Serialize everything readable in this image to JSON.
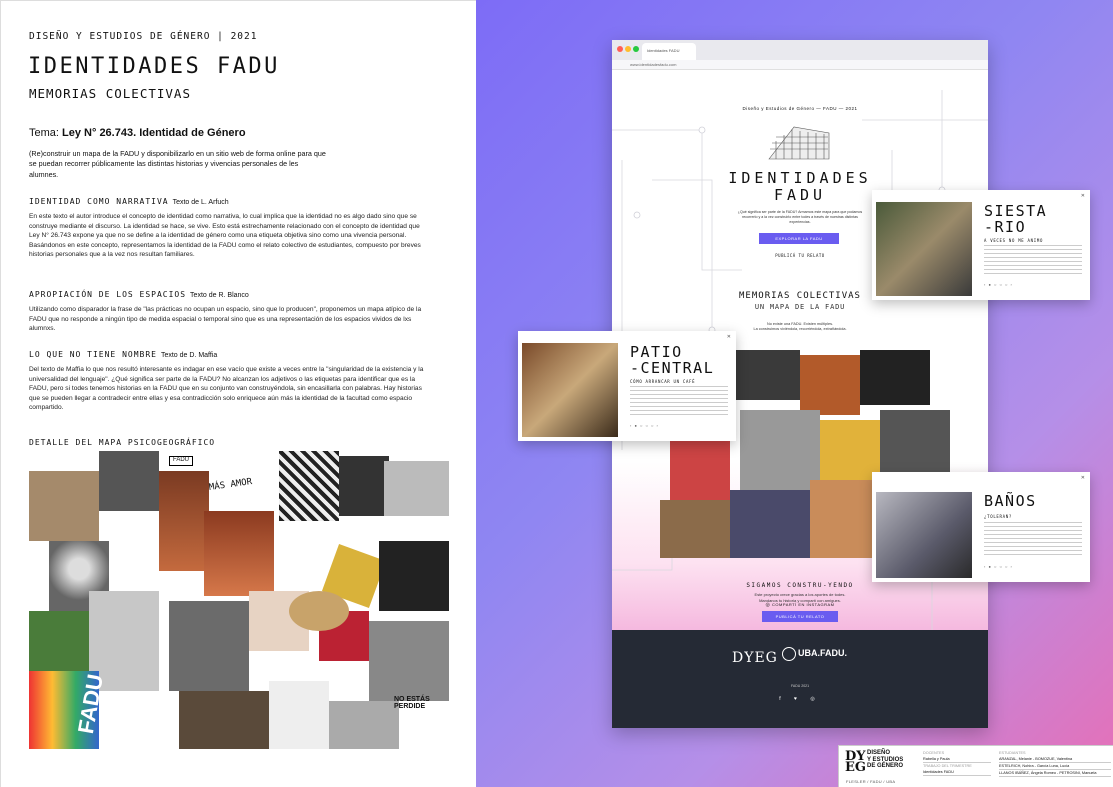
{
  "left": {
    "kicker": "DISEÑO Y ESTUDIOS DE GÉNERO | 2021",
    "title": "IDENTIDADES FADU",
    "subtitle": "MEMORIAS COLECTIVAS",
    "tema_label": "Tema:",
    "tema_value": "Ley N° 26.743. Identidad de Género",
    "intro": "(Re)construir un mapa de la FADU y disponibilizarlo en un sitio web de forma online para que se puedan recorrer públicamente las distintas historias y vivencias personales de les alumnes.",
    "sections": [
      {
        "heading": "IDENTIDAD COMO NARRATIVA",
        "author": "Texto de L. Arfuch",
        "body": "En este texto el autor introduce el concepto de identidad como narrativa, lo cual implica que la identidad no es algo dado sino que se construye mediante el discurso. La identidad se hace, se vive. Esto está estrechamente relacionado con el concepto de identidad que Ley N° 26.743 expone ya que no se define a la identidad de género como una etiqueta objetiva sino como una vivencia personal. Basándonos en este concepto, representamos la identidad de la FADU como el relato colectivo de estudiantes, compuesto por breves historias personales que a la vez nos resultan familiares."
      },
      {
        "heading": "APROPIACIÓN DE LOS ESPACIOS",
        "author": "Texto de R. Blanco",
        "body": "Utilizando como disparador la frase de \"las prácticas no ocupan un espacio, sino que lo producen\", proponemos un mapa atípico de la FADU que no responde a ningún tipo de medida espacial o temporal sino que es una representación de los espacios vividos de lxs alumnxs."
      },
      {
        "heading": "LO QUE NO TIENE NOMBRE",
        "author": "Texto de D. Maffia",
        "body": "Del texto de Maffia lo que nos resultó interesante es indagar en ese vacío que existe a veces entre la \"singularidad de la existencia y la universalidad del lenguaje\". ¿Qué significa ser parte de la FADU? No alcanzan los adjetivos o las etiquetas para identificar que es la FADU, pero si todes tenemos historias en la FADU que en su conjunto van construyéndola, sin encasillarla con palabras. Hay historias que se pueden llegar a contradecir entre ellas y esa contradicción solo enriquece aún más la identidad de la facultad como espacio compartido."
      }
    ],
    "map_heading": "DETALLE DEL MAPA PSICOGEOGRÁFICO",
    "collage_labels": {
      "fadu": "FADU",
      "mas_amor": "MÁS AMOR",
      "fadu_big": "FADU",
      "no_estas": "NO ESTÁS PERDIDE"
    }
  },
  "browser": {
    "tab_title": "Identidades FADU",
    "url": "www.identidadesfadu.com",
    "top_line": "Diseño y Estudios de Género — FADU — 2021",
    "hero_title_1": "IDENTIDADES",
    "hero_title_2": "FADU",
    "hero_text": "¿Qué significa ser parte de la FADU? Armamos este mapa para que podamos recorrerlo y a la vez construirlo entre todes a través de nuestras distintas experiencias.",
    "btn_explore": "EXPLORAR LA FADU",
    "link_publish": "PUBLICÁ TU RELATO",
    "sec2_title": "MEMORIAS COLECTIVAS",
    "sec2_sub": "UN MAPA DE LA FADU",
    "sec2_text_1": "No existe una FADU. Existen múltiples.",
    "sec2_text_2": "La construimos viviéndola, recorriéndola, extrañándola.",
    "cta_title": "SIGAMOS CONSTRU-YENDO",
    "cta_text_1": "Este proyecto crece gracias a los aportes de todes.",
    "cta_text_2": "Mandanos tu historia y compartí con amigues.",
    "btn_publish": "PUBLICÁ TU RELATO",
    "instagram": "COMPARTÍ EN INSTAGRAM",
    "footer_dyeg": "DYEG",
    "footer_uba": "UBA.FADU.",
    "footer_year": "FADU 2021",
    "footer_social": "f ♥ ◎"
  },
  "cards": [
    {
      "title": "SIESTA\n-RIO",
      "sub": "A VECES NO ME ANIMO"
    },
    {
      "title": "PATIO\n-CENTRAL",
      "sub": "CÓMO ARRANCAR UN CAFÉ"
    },
    {
      "title": "BAÑOS",
      "sub": "¿TOLERAN?"
    }
  ],
  "logo": {
    "mark": "DY\nEG",
    "name_1": "DISEÑO",
    "name_2": "Y ESTUDIOS",
    "name_3": "DE GÉNERO",
    "flesler": "FLESLER / FADU / UBA",
    "col1": [
      [
        "DOCENTES",
        ""
      ],
      [
        "Rabella y Paula",
        ""
      ],
      [
        "TRABAJO DEL TRIMESTRE",
        ""
      ],
      [
        "Identidades FADU",
        ""
      ]
    ],
    "col2": [
      [
        "ESTUDIANTES",
        ""
      ],
      [
        "ARANZAL, Melanie - BOMOZUE, Valentina",
        ""
      ],
      [
        "ESTELRICH, Nohira - García Luna, Lucía",
        ""
      ],
      [
        "LLANOS IBÁÑEZ, Ángela Romeo - PETROSINI, Manuela",
        ""
      ]
    ]
  },
  "colors": {
    "accent": "#6a5cf0",
    "footer": "#252a35",
    "gradient_start": "#7d6cf6",
    "gradient_end": "#e76fb6"
  }
}
